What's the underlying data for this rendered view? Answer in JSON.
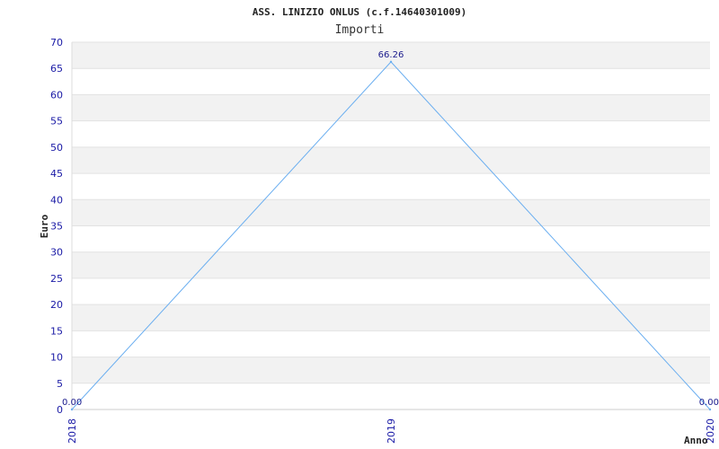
{
  "chart_data": {
    "type": "line",
    "title": "ASS. LINIZIO ONLUS (c.f.14640301009)",
    "subtitle": "Importi",
    "xlabel": "Anno",
    "ylabel": "Euro",
    "categories": [
      "2018",
      "2019",
      "2020"
    ],
    "series": [
      {
        "values": [
          0.0,
          66.26,
          0.0
        ],
        "data_labels": [
          "0.00",
          "66.26",
          "0.00"
        ]
      }
    ],
    "ylim": [
      0,
      70
    ],
    "yticks": [
      0,
      5,
      10,
      15,
      20,
      25,
      30,
      35,
      40,
      45,
      50,
      55,
      60,
      65,
      70
    ],
    "grid": true,
    "legend": "none",
    "colors": {
      "line": "#6aaef0",
      "band_alt": "#f2f2f2",
      "band": "#ffffff",
      "tick_text": "#1a1aa6",
      "axis": "#cccccc"
    }
  }
}
